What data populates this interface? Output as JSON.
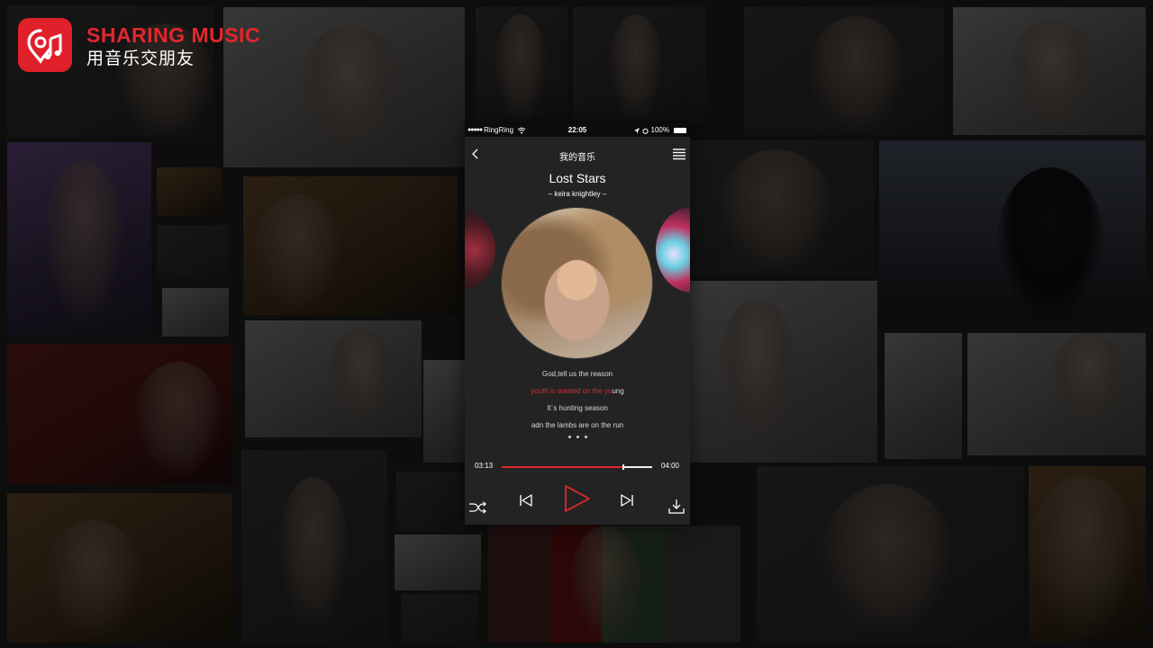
{
  "brand": {
    "title": "SHARING MUSIC",
    "subtitle": "用音乐交朋友",
    "logo_icon": "music-pin-icon",
    "accent_color": "#e4262c"
  },
  "status_bar": {
    "carrier": "RingRing",
    "signal_dots": "●●●●●",
    "time": "22:05",
    "battery": "100%"
  },
  "nav": {
    "title": "我的音乐",
    "back_icon": "chevron-left-icon",
    "menu_icon": "hamburger-menu-icon"
  },
  "song": {
    "title": "Lost Stars",
    "artist": "–  keira knightley  –"
  },
  "lyrics": {
    "line1": "God,tell us the reason",
    "line2_sung": "youth is wasted on the yo",
    "line2_rest": "ung",
    "line3": "It`s hunting season",
    "line4": "adn the lambs are on the run"
  },
  "player": {
    "current_time": "03:13",
    "total_time": "04:00",
    "progress": 0.8,
    "buffered": 0.8,
    "controls": [
      "shuffle-icon",
      "previous-icon",
      "play-icon",
      "next-icon",
      "download-icon"
    ]
  }
}
